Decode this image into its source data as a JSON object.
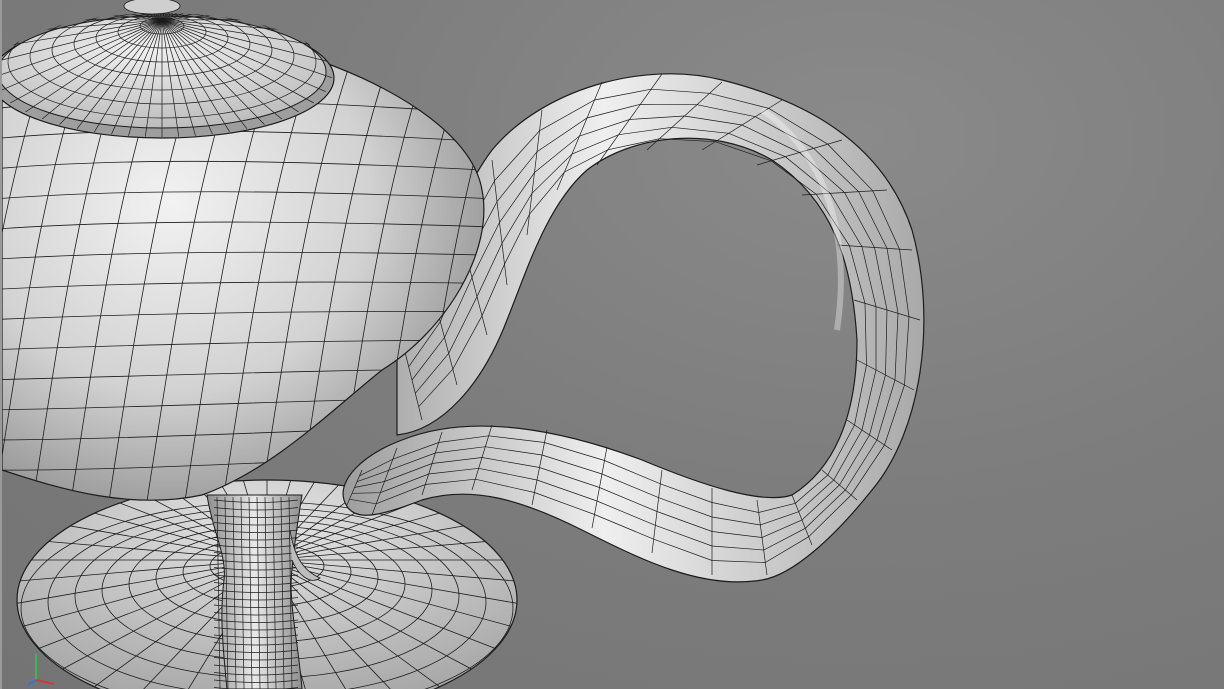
{
  "viewport": {
    "background": "#7b7b7b",
    "wire_color": "#1c1c1c",
    "surface_light": "#e6e6e6",
    "surface_dark": "#8f8f8f",
    "render_mode": "shaded-wireframe"
  },
  "axis_gizmo": {
    "x_color": "#d23a3a",
    "y_color": "#3ab84a",
    "z_color": "#3a6fd8"
  }
}
